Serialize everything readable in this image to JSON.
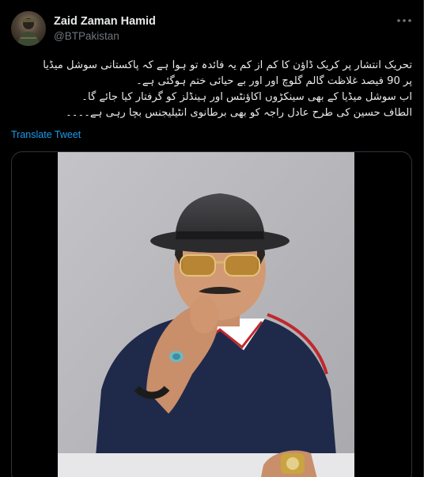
{
  "author": {
    "name": "Zaid Zaman Hamid",
    "handle": "@BTPakistan",
    "avatar_icon": "person-avatar"
  },
  "more_icon": "more-options-icon",
  "tweet": {
    "lines": [
      "تحریک انتشار پر کریک ڈاؤن کا کم از کم یہ فائدہ تو ہوا ہے کہ پاکستانی سوشل میڈیا",
      "پر 90 فیصد غلاظت گالم گلوچ اور اور بے حیائی ختم ہوگئی ہے۔",
      "اب سوشل میڈیا کے بھی سینکڑوں اکاؤنٹس اور ہینڈلز کو گرفتار کیا جائے گا۔",
      "الطاف حسین کی طرح عادل راجہ کو بھی برطانوی انٹیلیجنس بچا رہی ہے۔۔۔۔"
    ],
    "translate_label": "Translate Tweet"
  },
  "colors": {
    "background": "#000000",
    "text": "#e7e9ea",
    "secondary_text": "#71767b",
    "link": "#1d9bf0",
    "border": "#2f3336"
  },
  "media": {
    "type": "video-thumbnail",
    "icons": [
      "fedora-hat",
      "sunglasses",
      "polo-shirt",
      "ring",
      "bracelet",
      "wristwatch"
    ]
  }
}
